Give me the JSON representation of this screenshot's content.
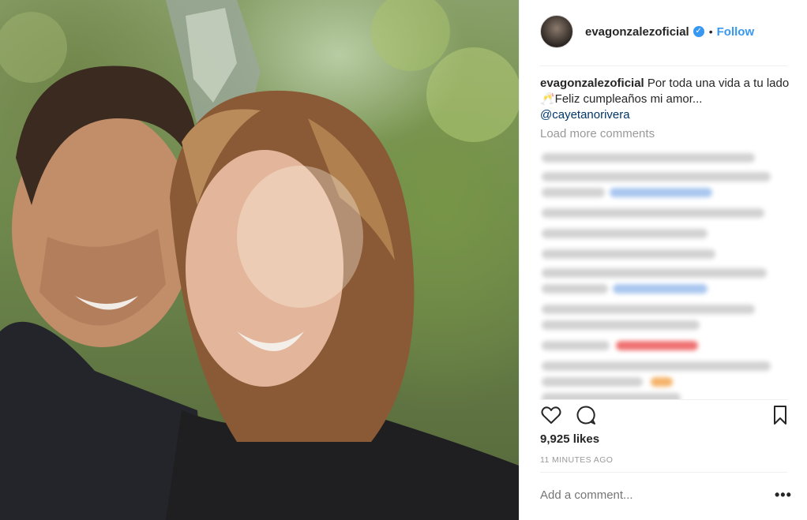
{
  "post": {
    "username": "evagonzalezoficial",
    "follow_label": "Follow",
    "separator": "•",
    "caption_text": "Por toda una vida a tu lado 🥂Feliz cumpleaños mi amor...",
    "mention": "@cayetanorivera",
    "load_more": "Load more comments",
    "likes": "9,925 likes",
    "time": "11 MINUTES AGO",
    "add_comment_placeholder": "Add a comment...",
    "more_options": "•••"
  },
  "icons": {
    "verified": "verified-badge-icon",
    "like": "heart-icon",
    "comment": "comment-bubble-icon",
    "save": "bookmark-icon",
    "more": "more-options-icon"
  },
  "colors": {
    "accent": "#3897f0",
    "text": "#262626",
    "muted": "#999999",
    "mention": "#003569"
  }
}
